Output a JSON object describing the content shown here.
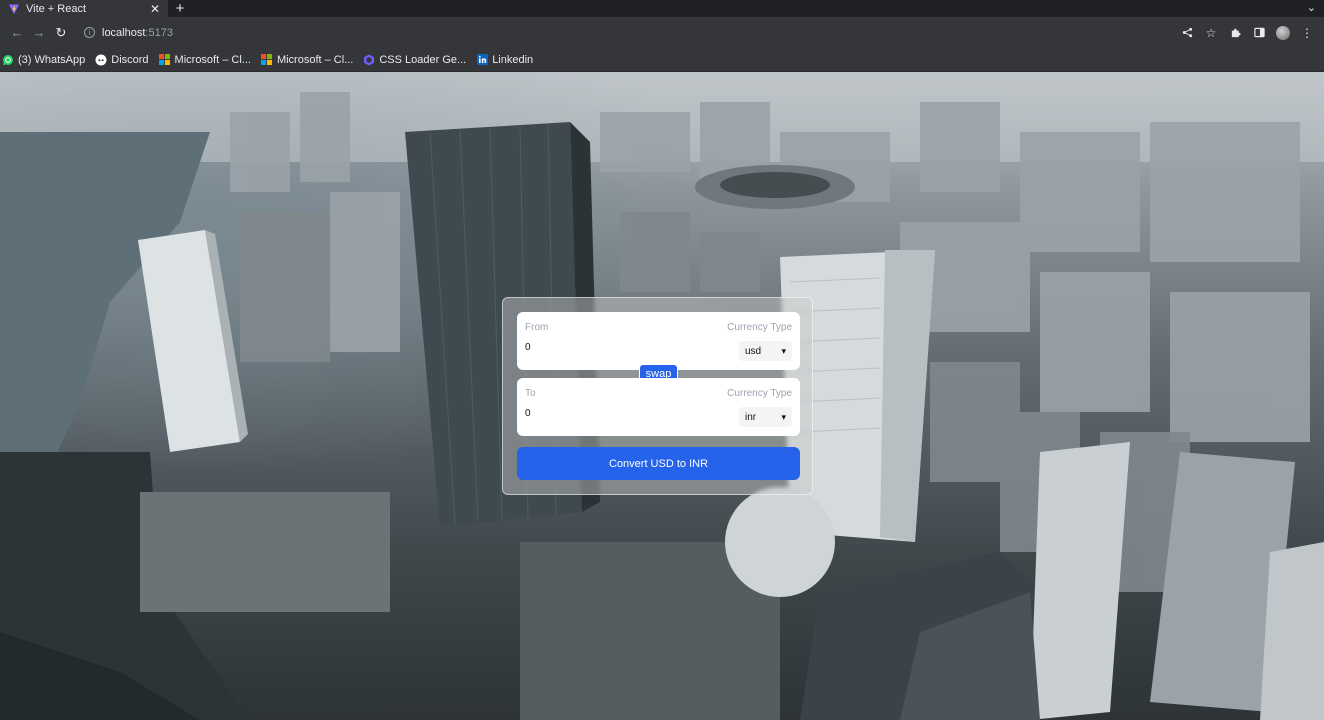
{
  "browser": {
    "tab": {
      "title": "Vite + React",
      "close_glyph": "✕",
      "favicon": "vite-icon"
    },
    "new_tab_glyph": "+",
    "tab_menu_glyph": "⌄",
    "nav": {
      "back": "←",
      "forward": "→",
      "reload": "↻"
    },
    "address": {
      "host": "localhost",
      "port": ":5173"
    },
    "toolbar_icons": [
      "share-icon",
      "star-icon",
      "extensions-icon",
      "sidebar-icon",
      "profile-avatar",
      "menu-icon"
    ]
  },
  "bookmarks": [
    {
      "label": "(3) WhatsApp",
      "icon": "whatsapp-icon",
      "color": "#25d366"
    },
    {
      "label": "Discord",
      "icon": "discord-icon",
      "color": "#ffffff"
    },
    {
      "label": "Microsoft – Cl...",
      "icon": "microsoft-icon",
      "color": "#f25022"
    },
    {
      "label": "Microsoft – Cl...",
      "icon": "microsoft-icon",
      "color": "#f25022"
    },
    {
      "label": "CSS Loader Ge...",
      "icon": "css-loader-icon",
      "color": "#6d5dfc"
    },
    {
      "label": "Linkedin",
      "icon": "linkedin-icon",
      "color": "#0a66c2"
    }
  ],
  "converter": {
    "from": {
      "label": "From",
      "type_label": "Currency Type",
      "amount": "0",
      "currency": "usd"
    },
    "to": {
      "label": "To",
      "type_label": "Currency Type",
      "amount": "0",
      "currency": "inr"
    },
    "swap_label": "swap",
    "convert_label": "Convert USD to INR",
    "accent": "#2563eb"
  }
}
